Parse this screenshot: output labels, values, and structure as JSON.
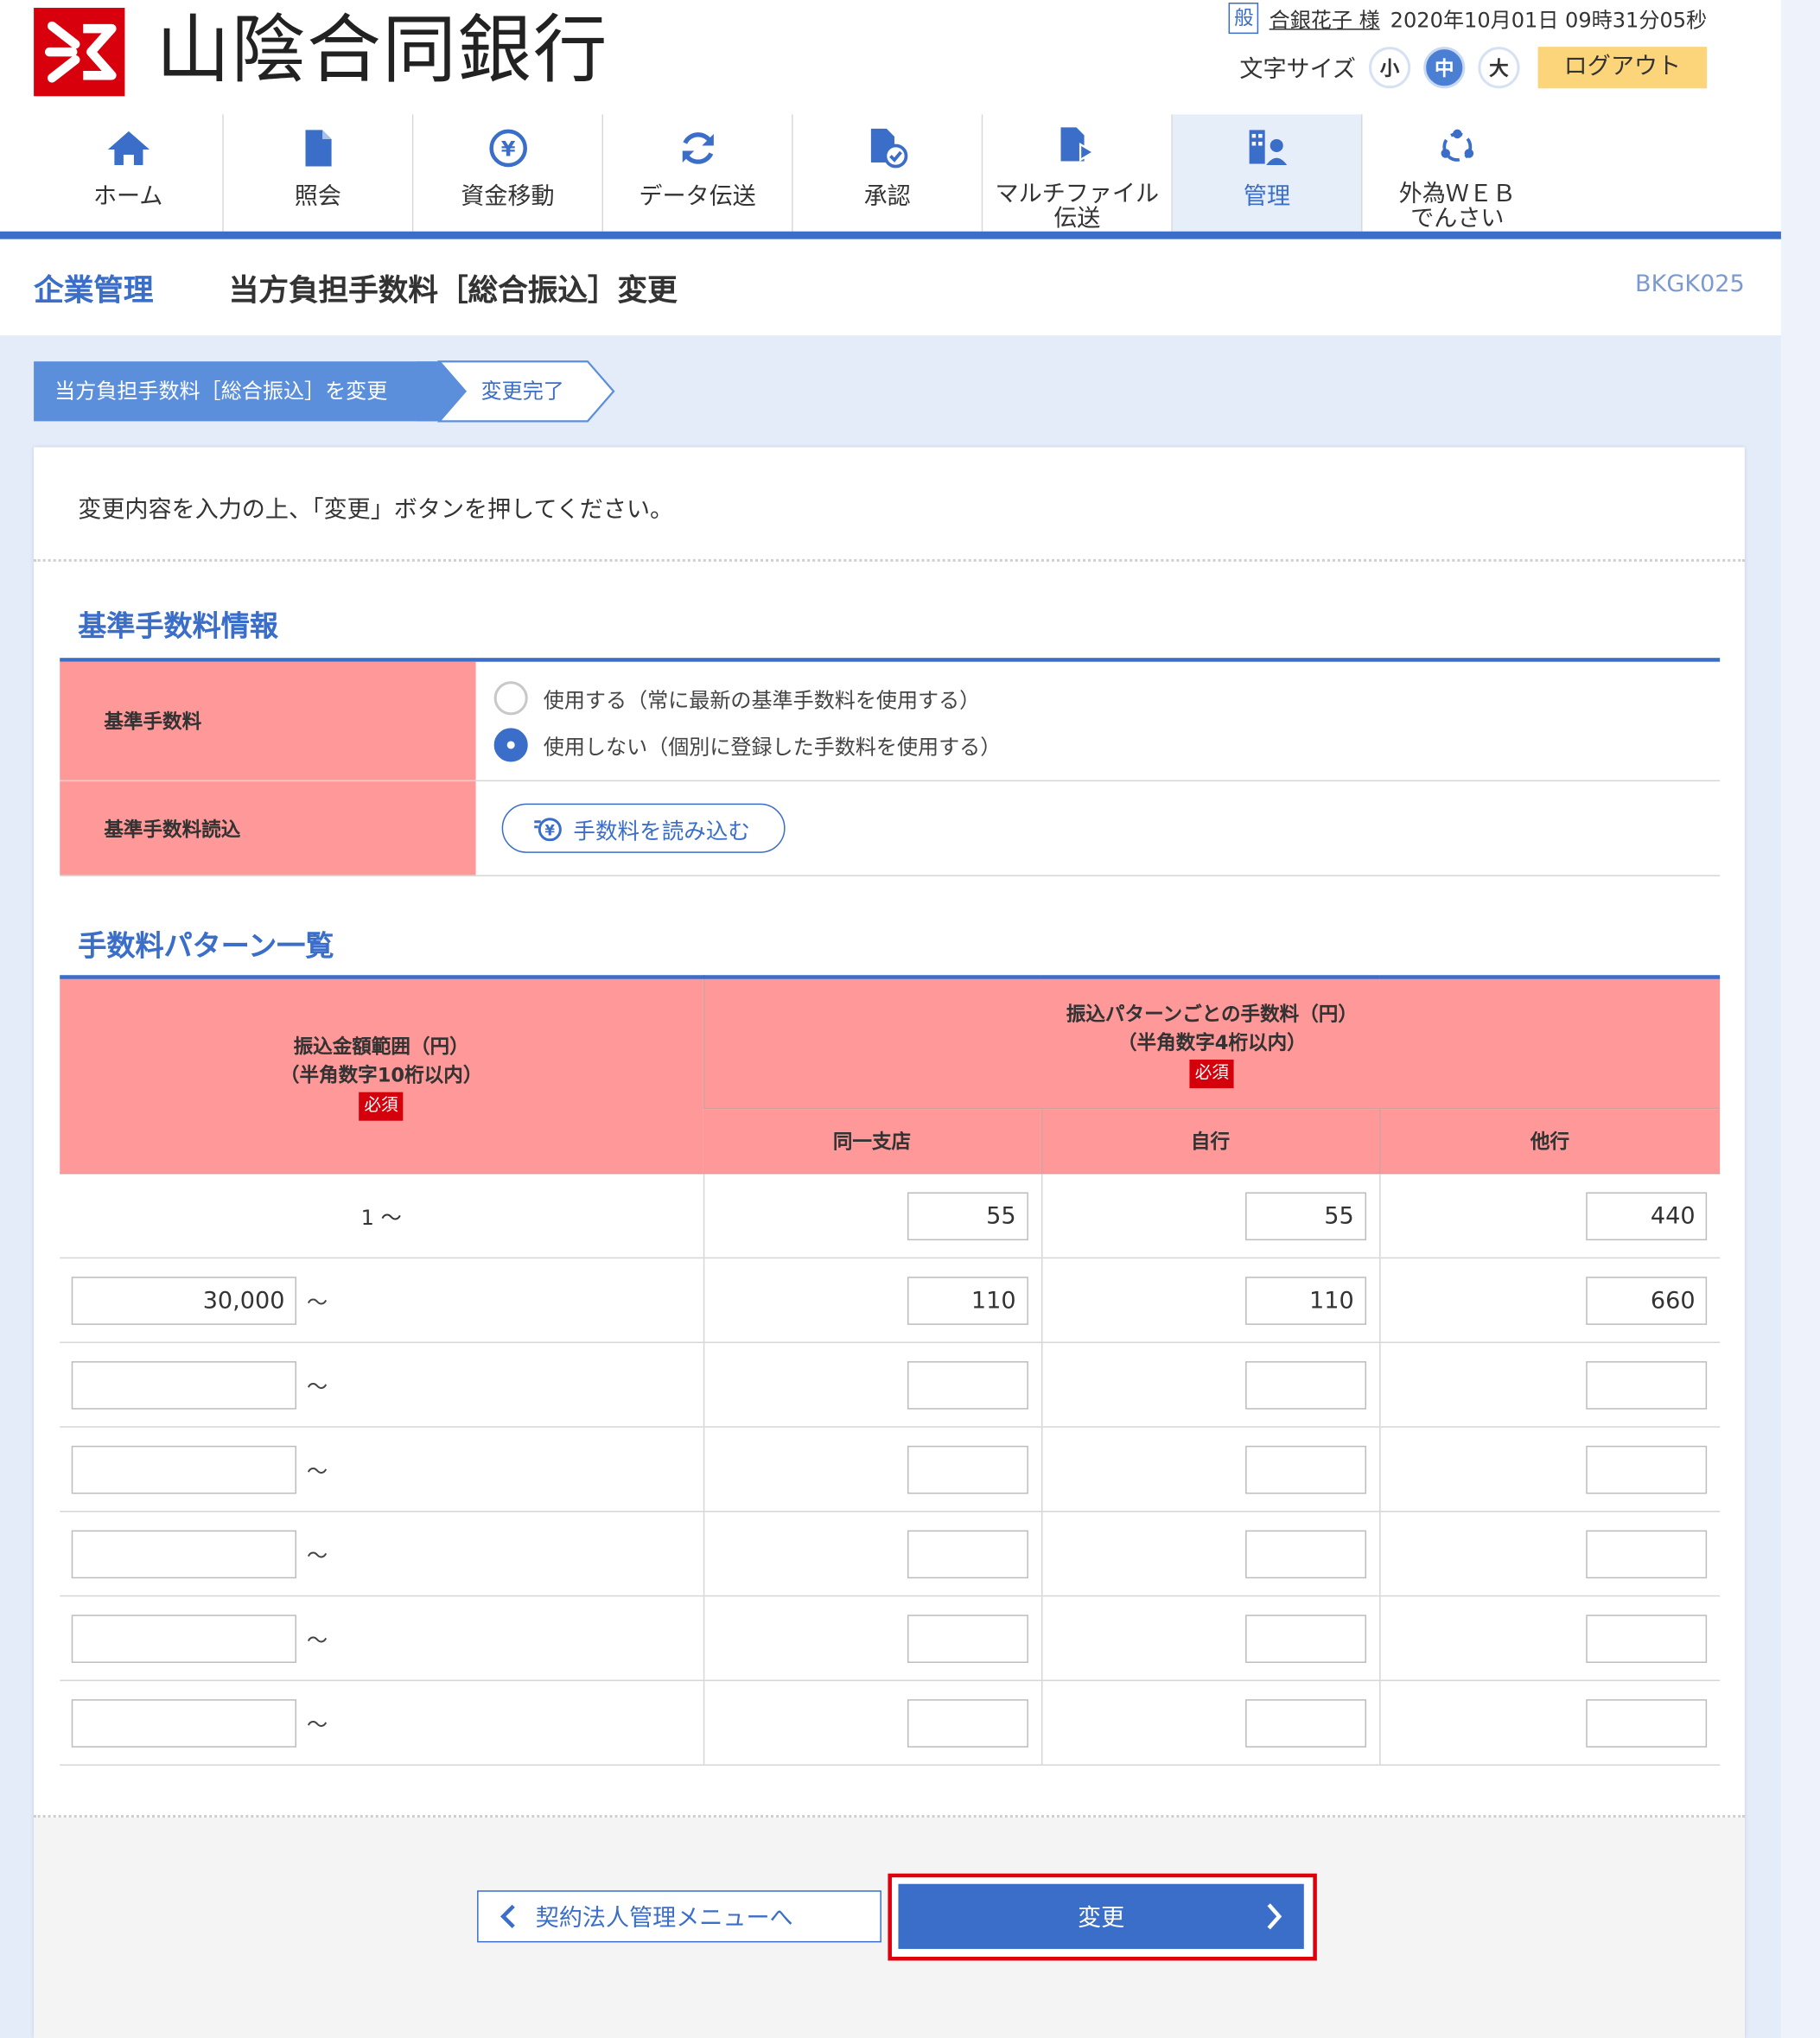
{
  "bank": {
    "name": "山陰合同銀行"
  },
  "user": {
    "badge": "般",
    "name": "合銀花子 様",
    "datetime": "2020年10月01日 09時31分05秒",
    "font_size_label": "文字サイズ",
    "font_sizes": [
      "小",
      "中",
      "大"
    ],
    "logout": "ログアウト"
  },
  "nav": [
    {
      "label": "ホーム",
      "icon": "home-icon"
    },
    {
      "label": "照会",
      "icon": "document-icon"
    },
    {
      "label": "資金移動",
      "icon": "yen-transfer-icon"
    },
    {
      "label": "データ伝送",
      "icon": "refresh-icon"
    },
    {
      "label": "承認",
      "icon": "approve-icon"
    },
    {
      "label": "マルチファイル\n伝送",
      "icon": "file-upload-icon"
    },
    {
      "label": "管理",
      "icon": "management-icon",
      "active": true
    },
    {
      "label": "外為ＷＥＢ\nでんさい",
      "icon": "network-icon"
    }
  ],
  "title": {
    "section": "企業管理",
    "page": "当方負担手数料［総合振込］変更",
    "code": "BKGK025"
  },
  "steps": [
    "当方負担手数料［総合振込］を変更",
    "変更完了"
  ],
  "intro": "変更内容を入力の上、「変更」ボタンを押してください。",
  "base": {
    "heading": "基準手数料情報",
    "fee_label": "基準手数料",
    "options": [
      "使用する（常に最新の基準手数料を使用する）",
      "使用しない（個別に登録した手数料を使用する）"
    ],
    "selected_index": 1,
    "load_label": "基準手数料読込",
    "load_button": "手数料を読み込む"
  },
  "patterns": {
    "heading": "手数料パターン一覧",
    "col_range": "振込金額範囲（円）",
    "col_range_note": "（半角数字10桁以内）",
    "col_fee": "振込パターンごとの手数料（円）",
    "col_fee_note": "（半角数字4桁以内）",
    "required": "必須",
    "sub_cols": [
      "同一支店",
      "自行",
      "他行"
    ],
    "first_row_range": "1 ～",
    "tilde": "～",
    "rows": [
      {
        "from": "",
        "same_branch": "55",
        "own_bank": "55",
        "other_bank": "440"
      },
      {
        "from": "30,000",
        "same_branch": "110",
        "own_bank": "110",
        "other_bank": "660"
      },
      {
        "from": "",
        "same_branch": "",
        "own_bank": "",
        "other_bank": ""
      },
      {
        "from": "",
        "same_branch": "",
        "own_bank": "",
        "other_bank": ""
      },
      {
        "from": "",
        "same_branch": "",
        "own_bank": "",
        "other_bank": ""
      },
      {
        "from": "",
        "same_branch": "",
        "own_bank": "",
        "other_bank": ""
      },
      {
        "from": "",
        "same_branch": "",
        "own_bank": "",
        "other_bank": ""
      }
    ]
  },
  "buttons": {
    "back": "契約法人管理メニューへ",
    "submit": "変更"
  },
  "colors": {
    "primary": "#3b6ec9",
    "header_cell": "#ff9999",
    "required": "#d4000b",
    "logout": "#fcd47a",
    "highlight": "#e0000b"
  }
}
